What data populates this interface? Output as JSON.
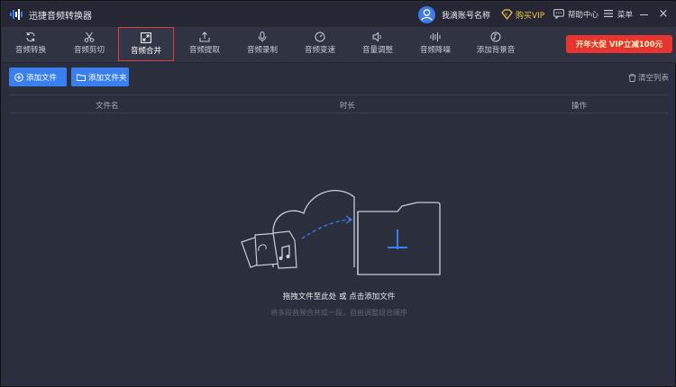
{
  "app": {
    "title": "迅捷音频转换器"
  },
  "header": {
    "username": "我滴账号名称",
    "vip_label": "购买VIP",
    "help_label": "帮助中心",
    "menu_label": "菜单"
  },
  "toolbar": {
    "items": [
      {
        "label": "音频转换",
        "icon": "refresh-icon"
      },
      {
        "label": "音频剪切",
        "icon": "scissors-icon"
      },
      {
        "label": "音频合并",
        "icon": "merge-icon",
        "active": true
      },
      {
        "label": "音频提取",
        "icon": "extract-icon"
      },
      {
        "label": "音频录制",
        "icon": "microphone-icon"
      },
      {
        "label": "音频变速",
        "icon": "speed-icon"
      },
      {
        "label": "音量调整",
        "icon": "volume-icon"
      },
      {
        "label": "音频降噪",
        "icon": "denoise-icon"
      },
      {
        "label": "添加背景音",
        "icon": "music-note-icon"
      }
    ],
    "promo": "开年大促 VIP立减100元"
  },
  "actions": {
    "add_file": "添加文件",
    "add_folder": "添加文件夹",
    "clear_list": "清空列表"
  },
  "table": {
    "columns": [
      "文件名",
      "时长",
      "操作"
    ]
  },
  "dropzone": {
    "hint": "拖拽文件至此处 或 点击添加文件",
    "sub": "将多段音频合并成一段，自由调整组合顺序"
  },
  "colors": {
    "accent": "#3a7ff0",
    "active_border": "#e03a3a",
    "vip": "#f2c447",
    "promo": "#e8342e"
  }
}
